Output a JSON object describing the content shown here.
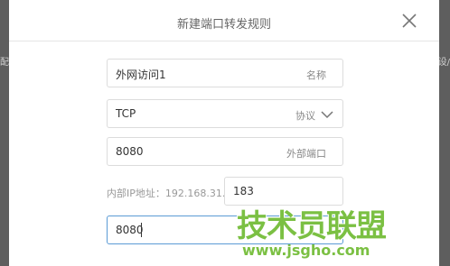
{
  "dialog": {
    "title": "新建端口转发规则"
  },
  "background": {
    "left_fragment": "配",
    "right_fragment": "设/"
  },
  "form": {
    "name_value": "外网访问1",
    "name_hint": "名称",
    "protocol_value": "TCP",
    "protocol_hint": "协议",
    "external_port_value": "8080",
    "external_port_hint": "外部端口",
    "internal_ip_label": "内部IP地址：192.168.31.",
    "internal_ip_last_octet": "183",
    "internal_port_value": "8080"
  },
  "watermark": {
    "main": "技术员联盟",
    "url": "www.jsgho.com"
  },
  "colors": {
    "overlay": "#6f6f6f",
    "active_border": "#5b9bd5",
    "watermark": "#7bc043"
  },
  "icons": [
    "close-icon",
    "chevron-down-icon"
  ]
}
